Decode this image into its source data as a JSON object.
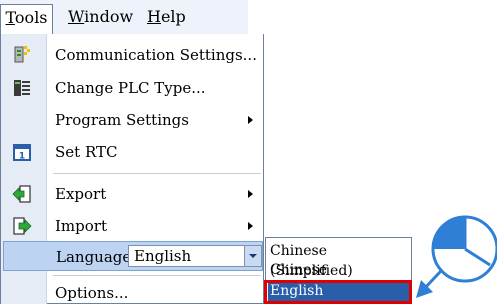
{
  "menubar": {
    "tools": "Tools",
    "tools_mn": "T",
    "tools_rest": "ools",
    "window_mn": "W",
    "window_rest": "indow",
    "help_mn": "H",
    "help_rest": "elp"
  },
  "tools_menu": {
    "items": [
      {
        "label": "Communication Settings...",
        "icon": "communication-settings-icon"
      },
      {
        "label": "Change PLC Type...",
        "icon": "change-plc-type-icon"
      },
      {
        "label": "Program Settings",
        "submenu": true
      },
      {
        "label": "Set RTC",
        "icon": "calendar-icon",
        "icon_text": "1"
      },
      {
        "label": "Export",
        "icon": "export-icon",
        "submenu": true
      },
      {
        "label": "Import",
        "icon": "import-icon",
        "submenu": true
      },
      {
        "label": "Language",
        "combo_value": "English"
      },
      {
        "label": "Options..."
      }
    ]
  },
  "language_list": {
    "options": [
      "Chinese (Simplified)",
      "Chinese (Traditional)",
      "English"
    ],
    "selected": "English"
  },
  "colors": {
    "highlight": "#e00000",
    "selection": "#2a5ea8",
    "pointer": "#2f7fd6"
  }
}
